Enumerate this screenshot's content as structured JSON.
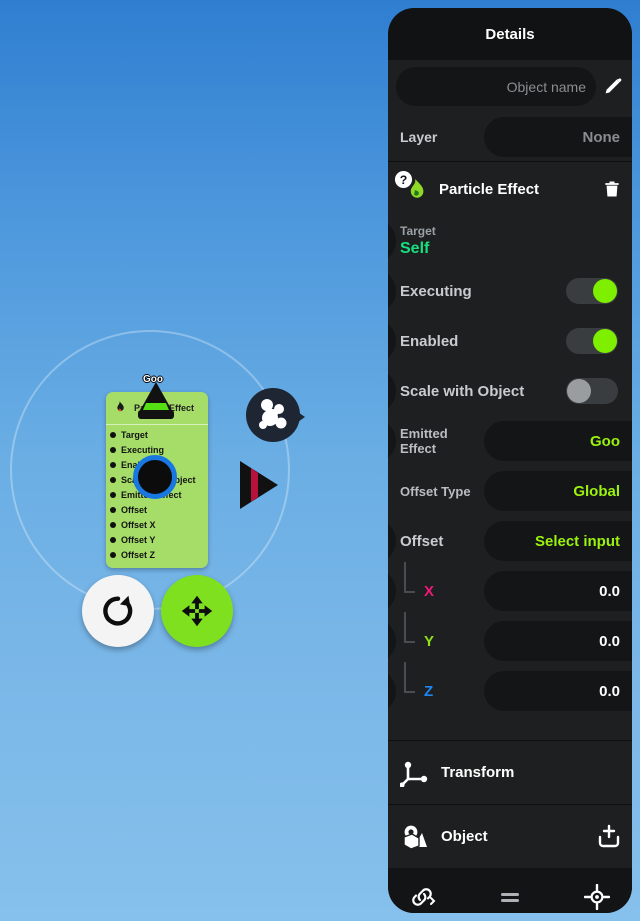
{
  "panel": {
    "title": "Details",
    "object_name_placeholder": "Object name",
    "edit_icon": "pencil-icon",
    "layer": {
      "label": "Layer",
      "value": "None"
    },
    "component": {
      "title": "Particle Effect",
      "icon": "flame-icon",
      "badge_icon": "question-mark-icon",
      "delete_icon": "trash-icon"
    },
    "properties": [
      {
        "key": "Target",
        "value": "Self",
        "type": "subvalue",
        "play": true,
        "play_active": true
      },
      {
        "key": "Executing",
        "value": "on",
        "type": "toggle",
        "play": true,
        "play_active": false
      },
      {
        "key": "Enabled",
        "value": "on",
        "type": "toggle",
        "play": true,
        "play_active": false
      },
      {
        "key": "Scale with Object",
        "value": "off",
        "type": "toggle",
        "play": true,
        "play_active": false
      },
      {
        "key": "Emitted Effect",
        "value": "Goo",
        "type": "pill",
        "play": true,
        "play_active": false
      },
      {
        "key": "Offset Type",
        "value": "Global",
        "type": "pill",
        "play": false,
        "play_active": false
      },
      {
        "key": "Offset",
        "value": "Select input",
        "type": "pill",
        "play": true,
        "play_active": false
      }
    ],
    "axes": [
      {
        "letter": "X",
        "value": "0.0",
        "color": "#f0197a"
      },
      {
        "letter": "Y",
        "value": "0.0",
        "color": "#8fe01b"
      },
      {
        "letter": "Z",
        "value": "0.0",
        "color": "#1f86ef"
      }
    ],
    "sections": [
      {
        "label": "Transform",
        "icon": "transform-axes-icon",
        "trail_icon": ""
      },
      {
        "label": "Object",
        "icon": "object-shapes-icon",
        "trail_icon": "add-to-tray-icon"
      }
    ],
    "footer": {
      "link_icon": "link-chain-icon",
      "menu_icon": "equals-menu-icon",
      "target_icon": "crosshair-target-icon"
    }
  },
  "canvas": {
    "node": {
      "title": "Particle Effect",
      "icon": "flame-icon",
      "ports": [
        "Target",
        "Executing",
        "Enabled",
        "Scale with Object",
        "Emitted Effect",
        "Offset",
        "Offset X",
        "Offset Y",
        "Offset Z"
      ]
    },
    "goo_marker_label": "Goo",
    "splat_badge_icon": "goo-splat-icon",
    "play_cursor_icon": "play-cursor-icon",
    "buttons": [
      {
        "name": "rotate-button",
        "icon": "rotate-cw-icon",
        "color": "#f4f4f4"
      },
      {
        "name": "move-button",
        "icon": "move-arrows-icon",
        "color": "#7fe01f"
      }
    ]
  },
  "colors": {
    "accent_green": "#9bf20c",
    "toggle_on": "#7fef00",
    "target_green": "#17e07e",
    "node_green": "#a5dd68",
    "sky_top": "#2f7ed0",
    "sky_bottom": "#86c0ec"
  }
}
